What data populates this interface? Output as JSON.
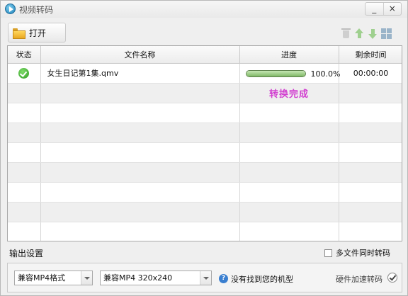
{
  "window": {
    "title": "视频转码",
    "minimize": "_",
    "close": "×"
  },
  "toolbar": {
    "open_label": "打开",
    "icons": [
      "trash-icon",
      "move-up-icon",
      "move-down-icon",
      "grid-view-icon"
    ]
  },
  "table": {
    "headers": [
      "状态",
      "文件名称",
      "进度",
      "剩余时间"
    ],
    "rows": [
      {
        "status_icon": "check-icon",
        "filename": "女生日记第1集.qmv",
        "progress": 1.0,
        "progress_text": "100.0%",
        "remaining": "00:00:00"
      }
    ],
    "status_message": "转换完成"
  },
  "output": {
    "label": "输出设置",
    "multi_file_label": "多文件同时转码",
    "multi_file_checked": false,
    "format_value": "兼容MP4格式",
    "resolution_value": "兼容MP4 320x240",
    "help_text": "没有找到您的机型",
    "hw_accel_label": "硬件加速转码",
    "hw_accel_checked": true
  },
  "colors": {
    "status_message": "#d23fd0",
    "progress_fill": "#7fb866"
  }
}
